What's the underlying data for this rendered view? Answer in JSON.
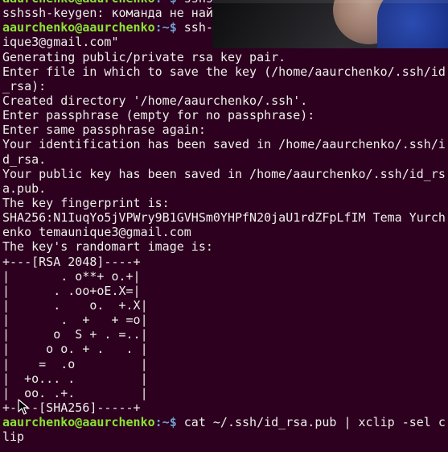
{
  "terminal": {
    "prompt_user": "aaurchenko@aaurchenko",
    "prompt_path": ":~$",
    "lines": [
      {
        "type": "prompt",
        "cmd": " sshs"
      },
      {
        "type": "text",
        "text": "sshssh-keygen: команда не най"
      },
      {
        "type": "prompt",
        "cmd": " ssh-"
      },
      {
        "type": "text",
        "text": "ique3@gmail.com\""
      },
      {
        "type": "text",
        "text": "Generating public/private rsa key pair."
      },
      {
        "type": "text",
        "text": "Enter file in which to save the key (/home/aaurchenko/.ssh/id"
      },
      {
        "type": "text",
        "text": "_rsa):"
      },
      {
        "type": "text",
        "text": "Created directory '/home/aaurchenko/.ssh'."
      },
      {
        "type": "text",
        "text": "Enter passphrase (empty for no passphrase):"
      },
      {
        "type": "text",
        "text": "Enter same passphrase again:"
      },
      {
        "type": "text",
        "text": "Your identification has been saved in /home/aaurchenko/.ssh/i"
      },
      {
        "type": "text",
        "text": "d_rsa."
      },
      {
        "type": "text",
        "text": "Your public key has been saved in /home/aaurchenko/.ssh/id_rs"
      },
      {
        "type": "text",
        "text": "a.pub."
      },
      {
        "type": "text",
        "text": "The key fingerprint is:"
      },
      {
        "type": "text",
        "text": "SHA256:N1IuqYo5jVPWry9B1GVHSm0YHPfN20jaU1rdZFpLfIM Tema Yurch"
      },
      {
        "type": "text",
        "text": "enko temaunique3@gmail.com"
      },
      {
        "type": "text",
        "text": "The key's randomart image is:"
      },
      {
        "type": "text",
        "text": "+---[RSA 2048]----+"
      },
      {
        "type": "text",
        "text": "|       . o**+ o.+|"
      },
      {
        "type": "text",
        "text": "|      . .oo+oE.X=|"
      },
      {
        "type": "text",
        "text": "|      .    o.  +.X|"
      },
      {
        "type": "text",
        "text": "|       .  +   + =o|"
      },
      {
        "type": "text",
        "text": "|      o  S + . =..|"
      },
      {
        "type": "text",
        "text": "|     o o. + .   . |"
      },
      {
        "type": "text",
        "text": "|    =  .o         |"
      },
      {
        "type": "text",
        "text": "|  +o... .         |"
      },
      {
        "type": "text",
        "text": "|  oo. .+.         |"
      },
      {
        "type": "text",
        "text": "+----[SHA256]-----+"
      },
      {
        "type": "prompt",
        "cmd": " cat ~/.ssh/id_rsa.pub | xclip -sel c"
      },
      {
        "type": "text",
        "text": "lip"
      }
    ]
  },
  "overlay": {
    "label": "webcam-overlay"
  },
  "colors": {
    "background": "#2c001e",
    "text": "#eeeeec",
    "prompt_user": "#8ae234",
    "prompt_path": "#729fcf"
  }
}
